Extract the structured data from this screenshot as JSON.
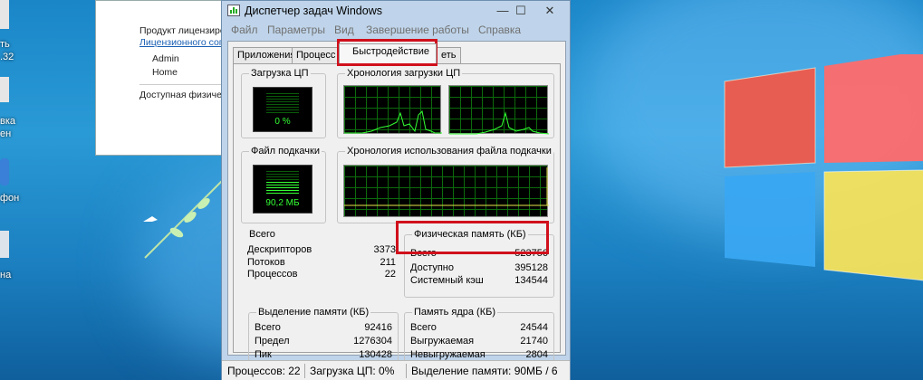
{
  "desktop": {
    "left_labels": [
      "ть",
      ".32",
      "вка",
      "ен",
      "фон",
      "на"
    ],
    "background_window": {
      "product_text": "Продукт лицензиро",
      "link_text": "Лицензионного сог",
      "user": "Admin",
      "edition": "Home",
      "memory_text": "Доступная физиче"
    }
  },
  "window": {
    "title": "Диспетчер задач Windows",
    "controls": {
      "minimize": "—",
      "maximize": "☐",
      "close": "✕"
    }
  },
  "menu": [
    "Файл",
    "Параметры",
    "Вид",
    "Завершение работы",
    "Справка"
  ],
  "tabs": {
    "apps": "Приложения",
    "processes": "Процесс",
    "performance": "Быстродействие",
    "network": "еть"
  },
  "performance": {
    "cpu_group": "Загрузка ЦП",
    "cpu_value": "0 %",
    "cpu_history_group": "Хронология загрузки ЦП",
    "page_group": "Файл подкачки",
    "page_value": "90,2 МБ",
    "page_history_group": "Хронология использования файла подкачки",
    "totals": {
      "title": "Всего",
      "rows": [
        {
          "label": "Дескрипторов",
          "value": "3373"
        },
        {
          "label": "Потоков",
          "value": "211"
        },
        {
          "label": "Процессов",
          "value": "22"
        }
      ]
    },
    "physical": {
      "title": "Физическая память (КБ)",
      "rows": [
        {
          "label": "Всего",
          "value": "523756"
        },
        {
          "label": "Доступно",
          "value": "395128"
        },
        {
          "label": "Системный кэш",
          "value": "134544"
        }
      ]
    },
    "commit": {
      "title": "Выделение памяти (КБ)",
      "rows": [
        {
          "label": "Всего",
          "value": "92416"
        },
        {
          "label": "Предел",
          "value": "1276304"
        },
        {
          "label": "Пик",
          "value": "130428"
        }
      ]
    },
    "kernel": {
      "title": "Память ядра (КБ)",
      "rows": [
        {
          "label": "Всего",
          "value": "24544"
        },
        {
          "label": "Выгружаемая",
          "value": "21740"
        },
        {
          "label": "Невыгружаемая",
          "value": "2804"
        }
      ]
    }
  },
  "status_bar": {
    "processes": "Процессов: 22",
    "cpu": "Загрузка ЦП: 0%",
    "memory": "Выделение памяти: 90МБ / 6"
  },
  "colors": {
    "highlight": "#d0101c",
    "graph_line": "#33ff33"
  }
}
